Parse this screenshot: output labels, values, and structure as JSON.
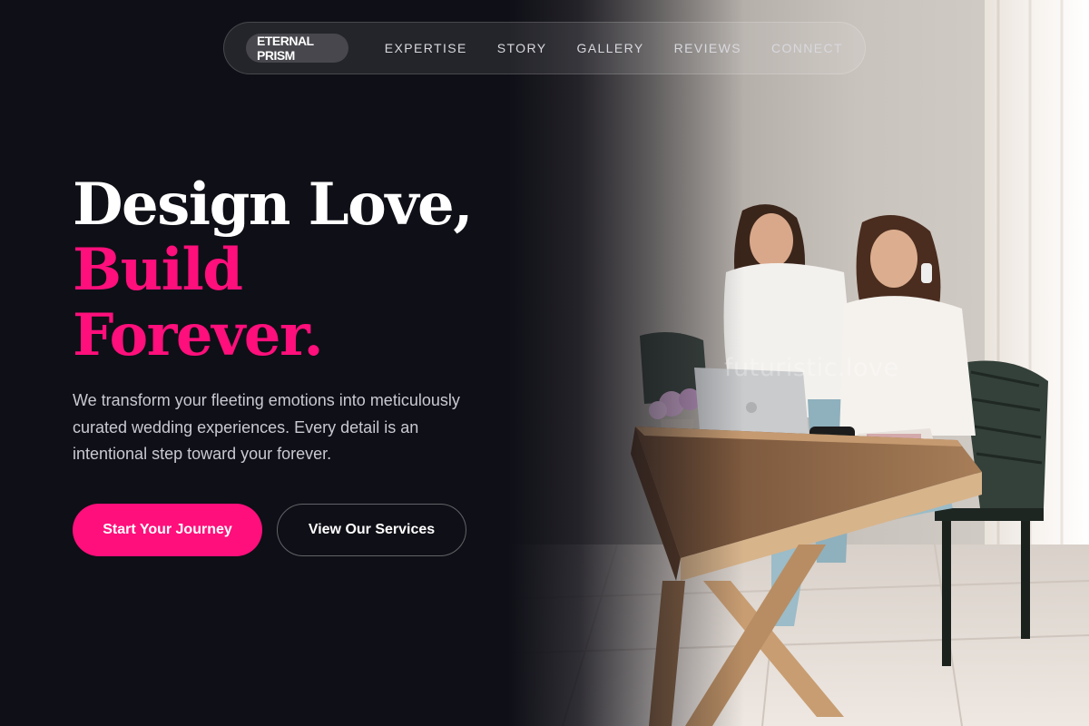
{
  "nav": {
    "brand": "ETERNAL PRISM",
    "links": [
      "EXPERTISE",
      "STORY",
      "GALLERY",
      "REVIEWS",
      "CONNECT"
    ]
  },
  "hero": {
    "title_line1": "Design Love,",
    "title_line2": "Build",
    "title_line3": "Forever.",
    "description": "We transform your fleeting emotions into meticulously curated wedding experiences. Every detail is an intentional step toward your forever.",
    "primary_cta": "Start Your Journey",
    "secondary_cta": "View Our Services"
  },
  "image": {
    "watermark": "futuristic.love"
  },
  "colors": {
    "background": "#0f0f17",
    "accent": "#ff0f7b",
    "text": "#ffffff",
    "muted_text": "#c9c9d2"
  }
}
